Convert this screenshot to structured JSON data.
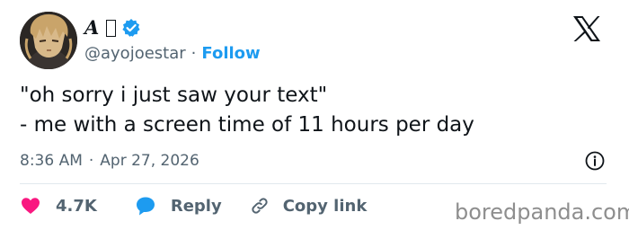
{
  "author": {
    "display_name": "𝑨",
    "handle": "@ayojoestar",
    "separator": "·",
    "follow_label": "Follow"
  },
  "tweet": {
    "line1": "\"oh sorry i just saw your text\"",
    "line2": "- me with a screen time of 11 hours per day"
  },
  "meta": {
    "time": "8:36 AM",
    "separator": "·",
    "date": "Apr 27, 2026"
  },
  "actions": {
    "likes_count": "4.7K",
    "reply_label": "Reply",
    "copy_link_label": "Copy link"
  },
  "watermark": "boredpanda.com",
  "icons": {
    "verified": "verified-badge-icon",
    "platform": "x-logo-icon",
    "info": "info-icon",
    "like": "heart-icon",
    "reply": "speech-bubble-icon",
    "copy": "link-icon"
  },
  "colors": {
    "accent": "#1d9bf0",
    "heart": "#f91880",
    "text": "#0f1419",
    "secondary": "#536471"
  }
}
